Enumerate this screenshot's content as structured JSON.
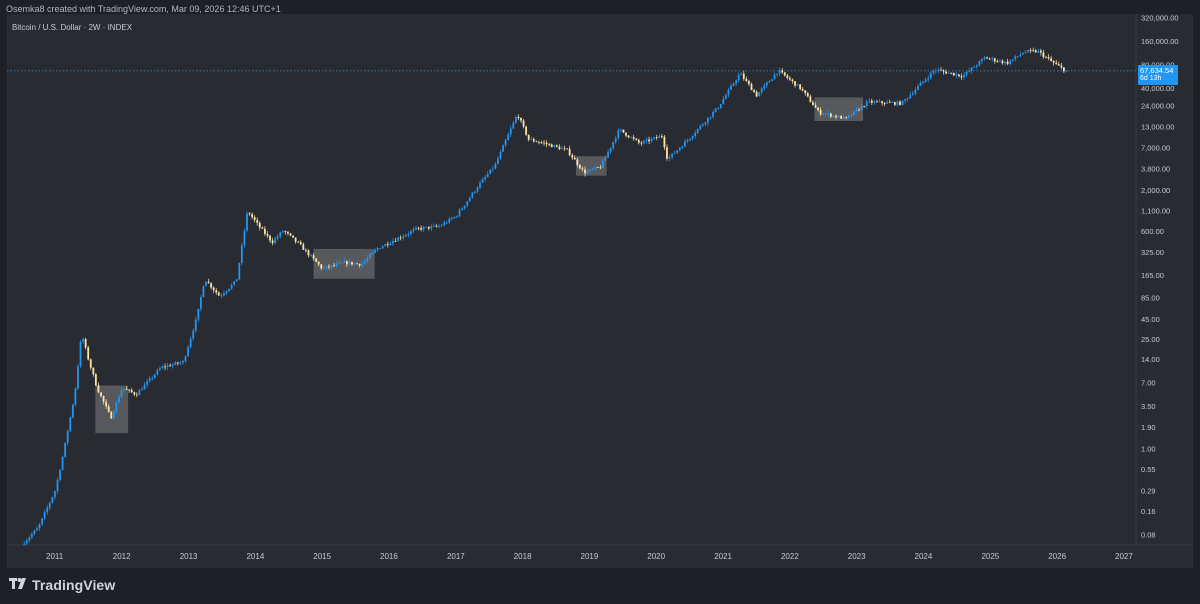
{
  "header": {
    "credit": "Osemka8 created with TradingView.com, Mar 09, 2026 12:46 UTC+1"
  },
  "footer": {
    "brand": "TradingView"
  },
  "symbol": {
    "title": "Bitcoin / U.S. Dollar · 2W · INDEX"
  },
  "price_tag": {
    "value": "67,634.54",
    "countdown": "6d 13h"
  },
  "colors": {
    "background": "#292b33",
    "up_candle": "#2196f3",
    "down_candle": "#ffe4a8",
    "highlight_box": "#808080",
    "price_line": "#2196f3"
  },
  "chart_data": {
    "type": "candlestick",
    "title": "Bitcoin / U.S. Dollar · 2W · INDEX",
    "y_scale": "log",
    "ylim": [
      0.05,
      400000
    ],
    "xlim": [
      "2010-07-01",
      "2027-03-01"
    ],
    "y_ticks": [
      "320,000.00",
      "160,000.00",
      "80,000.00",
      "40,000.00",
      "24,000.00",
      "13,000.00",
      "7,000.00",
      "3,800.00",
      "2,000.00",
      "1,100.00",
      "600.00",
      "325.00",
      "165.00",
      "85.00",
      "45.00",
      "25.00",
      "14.00",
      "7.00",
      "3.50",
      "1.90",
      "1.00",
      "0.55",
      "0.29",
      "0.16",
      "0.08"
    ],
    "x_ticks": [
      "2011",
      "2012",
      "2013",
      "2014",
      "2015",
      "2016",
      "2017",
      "2018",
      "2019",
      "2020",
      "2021",
      "2022",
      "2023",
      "2024",
      "2025",
      "2026",
      "2027"
    ],
    "last_price": 67634.54,
    "price_path": [
      [
        "2010-07-15",
        0.06
      ],
      [
        "2010-10-15",
        0.1
      ],
      [
        "2011-01-15",
        0.3
      ],
      [
        "2011-03-01",
        0.9
      ],
      [
        "2011-05-01",
        5.0
      ],
      [
        "2011-06-08",
        30.0
      ],
      [
        "2011-07-15",
        14.0
      ],
      [
        "2011-09-01",
        6.0
      ],
      [
        "2011-11-15",
        2.5
      ],
      [
        "2012-01-15",
        6.0
      ],
      [
        "2012-04-01",
        5.0
      ],
      [
        "2012-08-15",
        11.0
      ],
      [
        "2012-12-15",
        13.0
      ],
      [
        "2013-03-01",
        50.0
      ],
      [
        "2013-04-10",
        150.0
      ],
      [
        "2013-07-01",
        90.0
      ],
      [
        "2013-10-01",
        140.0
      ],
      [
        "2013-12-01",
        1100.0
      ],
      [
        "2014-02-01",
        700.0
      ],
      [
        "2014-04-15",
        440.0
      ],
      [
        "2014-06-15",
        620.0
      ],
      [
        "2014-09-15",
        400.0
      ],
      [
        "2015-01-15",
        200.0
      ],
      [
        "2015-05-15",
        240.0
      ],
      [
        "2015-08-15",
        230.0
      ],
      [
        "2015-11-15",
        370.0
      ],
      [
        "2016-06-15",
        650.0
      ],
      [
        "2016-10-15",
        700.0
      ],
      [
        "2017-01-15",
        950.0
      ],
      [
        "2017-05-15",
        2300.0
      ],
      [
        "2017-08-15",
        4200.0
      ],
      [
        "2017-12-15",
        19000.0
      ],
      [
        "2018-02-15",
        9000.0
      ],
      [
        "2018-05-15",
        8000.0
      ],
      [
        "2018-09-15",
        6500.0
      ],
      [
        "2018-12-15",
        3400.0
      ],
      [
        "2019-03-15",
        4000.0
      ],
      [
        "2019-06-25",
        12000.0
      ],
      [
        "2019-10-15",
        8000.0
      ],
      [
        "2020-02-15",
        10000.0
      ],
      [
        "2020-03-15",
        5000.0
      ],
      [
        "2020-07-15",
        9500.0
      ],
      [
        "2020-12-15",
        23000.0
      ],
      [
        "2021-04-15",
        63000.0
      ],
      [
        "2021-07-15",
        33000.0
      ],
      [
        "2021-11-10",
        68000.0
      ],
      [
        "2022-03-15",
        40000.0
      ],
      [
        "2022-06-20",
        20000.0
      ],
      [
        "2022-11-15",
        16500.0
      ],
      [
        "2023-03-15",
        27000.0
      ],
      [
        "2023-09-15",
        26000.0
      ],
      [
        "2024-03-15",
        70000.0
      ],
      [
        "2024-08-15",
        58000.0
      ],
      [
        "2024-12-15",
        100000.0
      ],
      [
        "2025-04-15",
        85000.0
      ],
      [
        "2025-07-15",
        118000.0
      ],
      [
        "2025-10-01",
        120000.0
      ],
      [
        "2025-12-15",
        88000.0
      ],
      [
        "2026-03-01",
        67634.54
      ]
    ],
    "highlight_boxes": [
      {
        "x0": "2011-08-15",
        "x1": "2012-02-10",
        "y0": 1.6,
        "y1": 6.5
      },
      {
        "x0": "2014-11-20",
        "x1": "2015-10-20",
        "y0": 150,
        "y1": 360
      },
      {
        "x0": "2018-10-25",
        "x1": "2019-04-10",
        "y0": 3100,
        "y1": 5500
      },
      {
        "x0": "2022-05-20",
        "x1": "2023-02-10",
        "y0": 15500,
        "y1": 31000
      }
    ]
  }
}
